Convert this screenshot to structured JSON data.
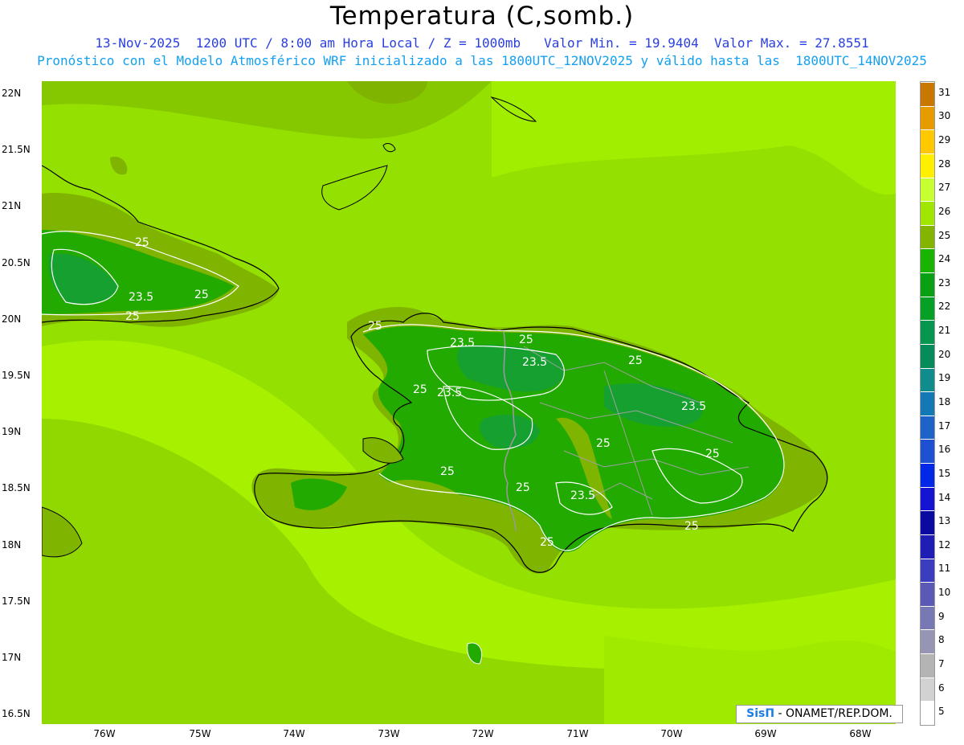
{
  "header": {
    "title": "Temperatura (C,somb.)",
    "line1": "13-Nov-2025  1200 UTC / 8:00 am Hora Local / Z = 1000mb   Valor Min. = 19.9404  Valor Max. = 27.8551",
    "line2": "Pronóstico con el Modelo Atmosférico WRF inicializado a las 1800UTC_12NOV2025 y válido hasta las  1800UTC_14NOV2025"
  },
  "axes": {
    "y_labels": [
      "22N",
      "21.5N",
      "21N",
      "20.5N",
      "20N",
      "19.5N",
      "19N",
      "18.5N",
      "18N",
      "17.5N",
      "17N",
      "16.5N"
    ],
    "x_labels": [
      "76W",
      "75W",
      "74W",
      "73W",
      "72W",
      "71W",
      "70W",
      "69W",
      "68W"
    ]
  },
  "contour_labels": [
    "25",
    "25",
    "23.5",
    "25",
    "25",
    "23.5",
    "25",
    "23.5",
    "25",
    "25",
    "23.5",
    "25",
    "23.5",
    "25",
    "25",
    "25",
    "23.5",
    "25",
    "25",
    "25"
  ],
  "colorbar": {
    "labels": [
      "31",
      "30",
      "29",
      "28",
      "27",
      "26",
      "25",
      "24",
      "23",
      "22",
      "21",
      "20",
      "19",
      "18",
      "17",
      "16",
      "15",
      "14",
      "13",
      "12",
      "11",
      "10",
      "9",
      "8",
      "7",
      "6",
      "5"
    ],
    "colors": [
      "#c87800",
      "#e69b00",
      "#ffc800",
      "#fff000",
      "#c8ff32",
      "#a0e600",
      "#82b400",
      "#19b400",
      "#0aa014",
      "#06a026",
      "#069650",
      "#068c5a",
      "#108c8c",
      "#1478b4",
      "#1e64c8",
      "#1e50d2",
      "#0028e6",
      "#1414d2",
      "#0a0aa0",
      "#1e1eb4",
      "#3c3cbe",
      "#5a5ab4",
      "#7878b4",
      "#9696b4",
      "#b4b4b4",
      "#d2d2d2",
      "#ffffff"
    ]
  },
  "palette": {
    "ocean_light": "#a8f000",
    "ocean_mid": "#92e000",
    "land_olive": "#7fb400",
    "land_green": "#22aa00",
    "land_dark": "#15a030"
  },
  "credit": {
    "brand": "SisΠ",
    "text": " - ONAMET/REP.DOM."
  }
}
